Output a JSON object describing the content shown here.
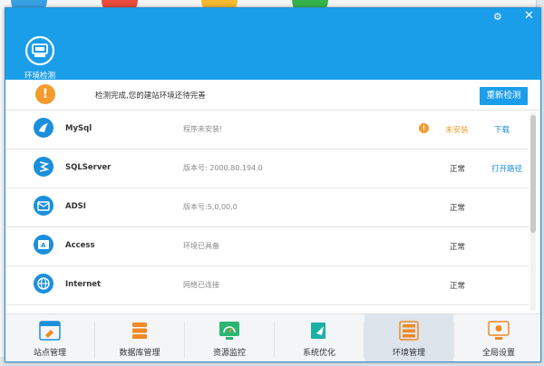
{
  "header": {
    "brand_label": "环境检测",
    "settings_icon": "gear-icon",
    "close_icon": "close-icon"
  },
  "status": {
    "message": "检测完成,您的建站环境还待完善",
    "recheck_label": "重新检测",
    "icon": "warning-icon"
  },
  "rows": [
    {
      "name": "MySql",
      "desc": "程序未安装!",
      "status": "未安装",
      "action": "下载",
      "icon": "dolphin-icon",
      "state_color": "#f39b2c"
    },
    {
      "name": "SQLServer",
      "desc": "版本号: 2000.80.194.0",
      "status": "正常",
      "action": "打开路径",
      "icon": "sqlserver-icon"
    },
    {
      "name": "ADSI",
      "desc": "版本号:5,0,00,0",
      "status": "正常",
      "action": "",
      "icon": "adsi-icon"
    },
    {
      "name": "Access",
      "desc": "环境已具备",
      "status": "正常",
      "action": "",
      "icon": "access-icon"
    },
    {
      "name": "Internet",
      "desc": "网络已连接",
      "status": "正常",
      "action": "",
      "icon": "globe-icon"
    }
  ],
  "nav": [
    {
      "label": "站点管理",
      "icon": "site-manage-icon",
      "color": "#1b8fdb"
    },
    {
      "label": "数据库管理",
      "icon": "database-manage-icon",
      "color": "#f08a24"
    },
    {
      "label": "资源监控",
      "icon": "resource-monitor-icon",
      "color": "#2bb673"
    },
    {
      "label": "系统优化",
      "icon": "system-optimize-icon",
      "color": "#1bb0a6"
    },
    {
      "label": "环境管理",
      "icon": "env-manage-icon",
      "color": "#f08a24"
    },
    {
      "label": "全局设置",
      "icon": "global-settings-icon",
      "color": "#f08a24"
    }
  ],
  "nav_active_index": 4,
  "accent_color": "#1b9ee9"
}
